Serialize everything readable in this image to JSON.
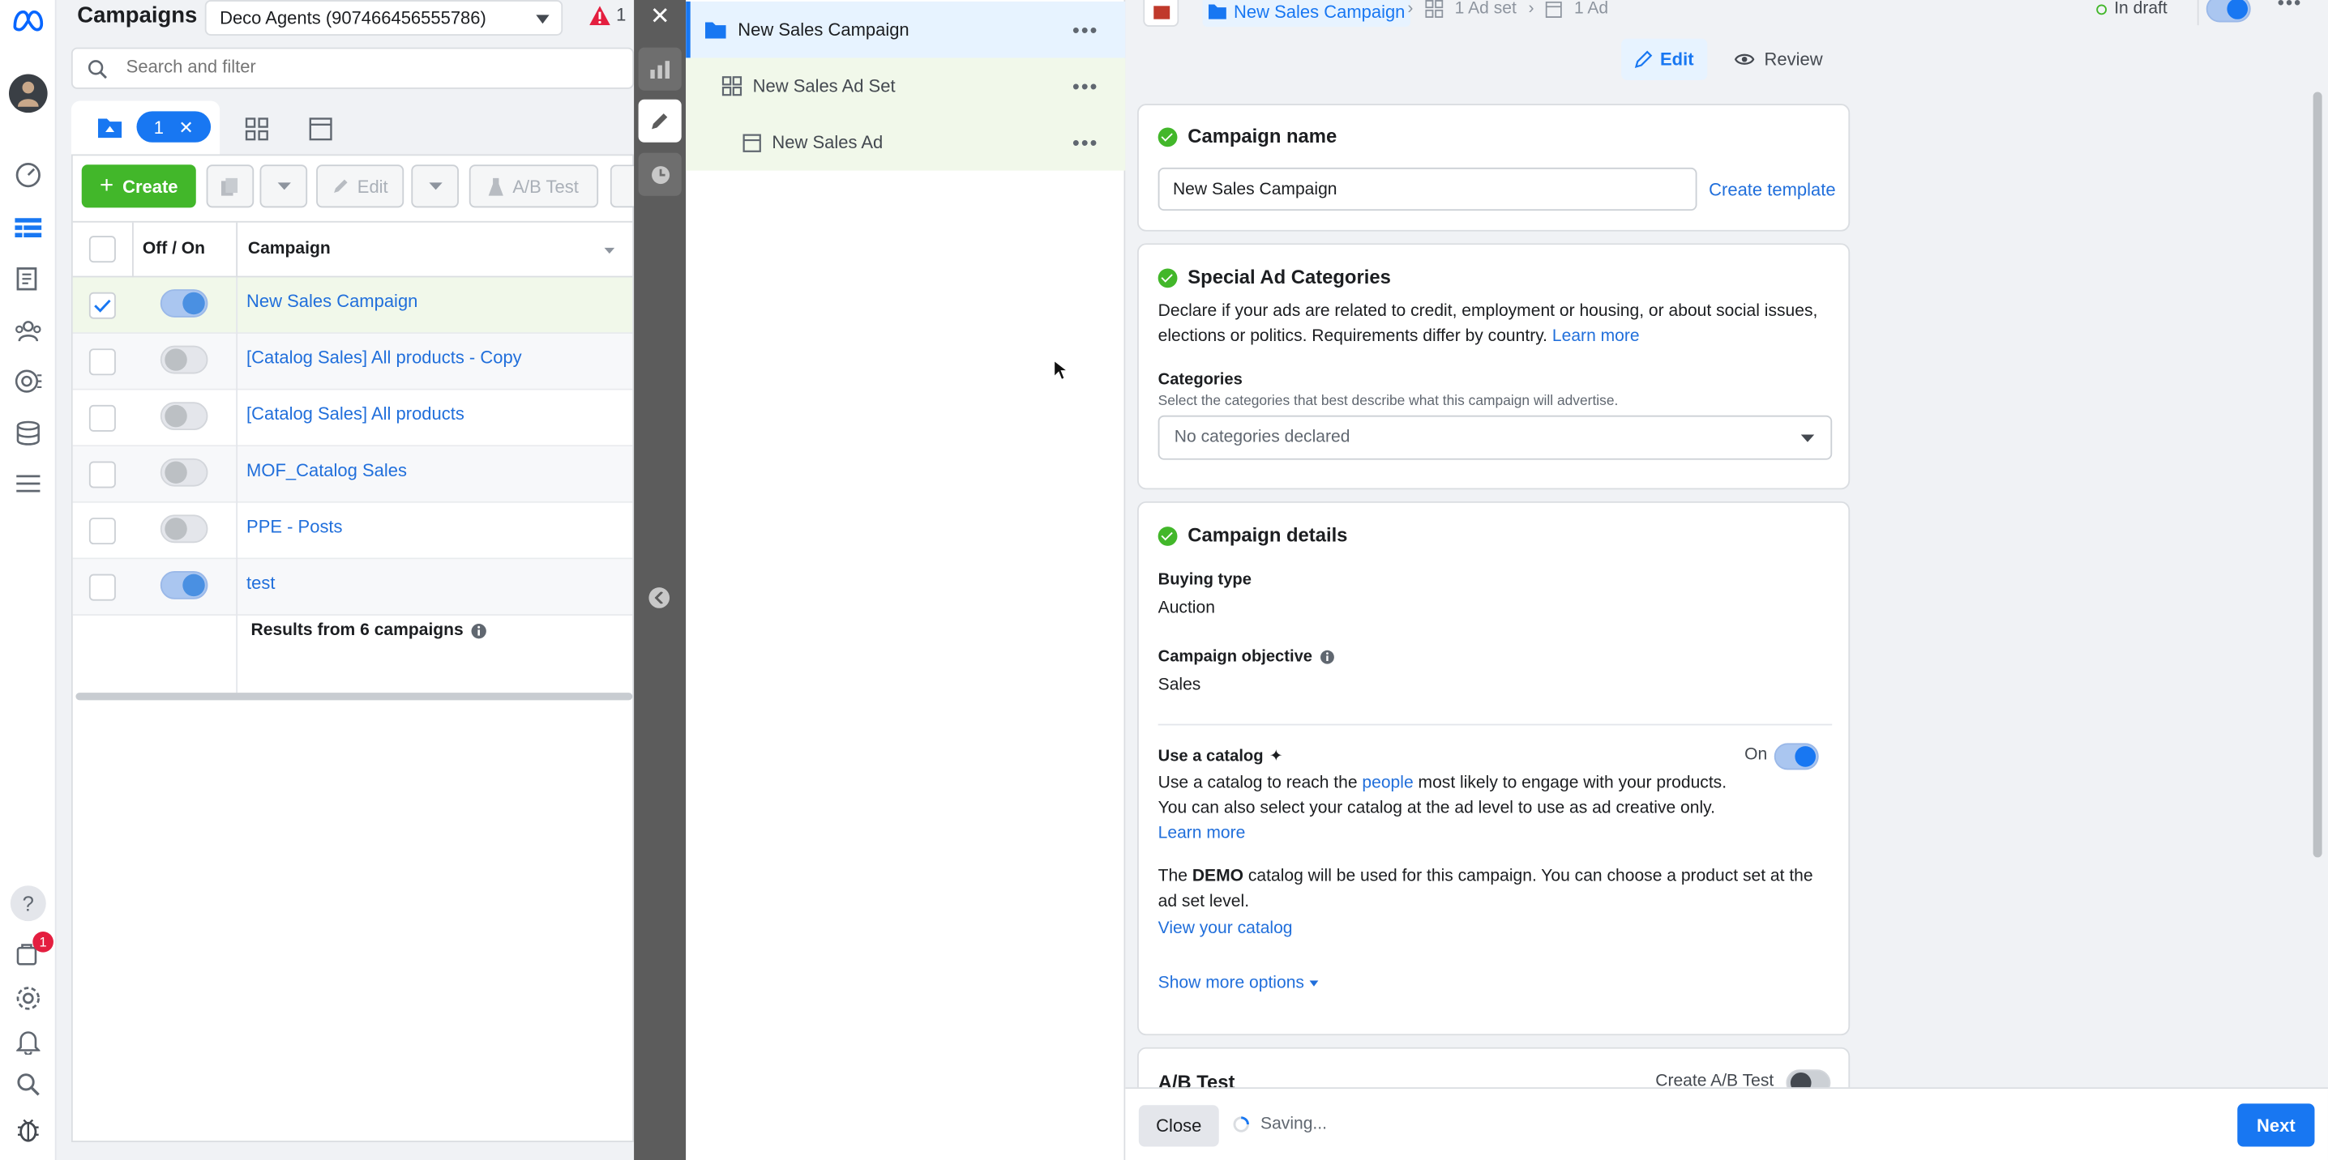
{
  "nav": {
    "help_label": "?",
    "notification_count": "1"
  },
  "campaigns": {
    "title": "Campaigns",
    "account": "Deco Agents (907466456555786)",
    "alert_count": "1",
    "search_placeholder": "Search and filter",
    "filter_count": "1",
    "toolbar": {
      "create": "Create",
      "edit": "Edit",
      "ab_test": "A/B Test"
    },
    "table": {
      "col_toggle": "Off / On",
      "col_campaign": "Campaign",
      "rows": [
        {
          "name": "New Sales Campaign",
          "on": true,
          "selected": true
        },
        {
          "name": "[Catalog Sales] All products - Copy",
          "on": false,
          "selected": false
        },
        {
          "name": "[Catalog Sales] All products",
          "on": false,
          "selected": false
        },
        {
          "name": "MOF_Catalog Sales",
          "on": false,
          "selected": false
        },
        {
          "name": "PPE - Posts",
          "on": false,
          "selected": false
        },
        {
          "name": "test",
          "on": true,
          "selected": false
        }
      ],
      "results": "Results from 6 campaigns"
    }
  },
  "tree": {
    "campaign": "New Sales Campaign",
    "adset": "New Sales Ad Set",
    "ad": "New Sales Ad"
  },
  "editor": {
    "breadcrumb": {
      "campaign": "New Sales Campaign",
      "adset": "1 Ad set",
      "ad": "1 Ad"
    },
    "status": "In draft",
    "tabs": {
      "edit": "Edit",
      "review": "Review"
    },
    "campaign_name": {
      "title": "Campaign name",
      "value": "New Sales Campaign",
      "create_template": "Create template"
    },
    "special": {
      "title": "Special Ad Categories",
      "desc": "Declare if your ads are related to credit, employment or housing, or about social issues, elections or politics. Requirements differ by country.",
      "learn_more": "Learn more",
      "categories_label": "Categories",
      "categories_help": "Select the categories that best describe what this campaign will advertise.",
      "categories_value": "No categories declared"
    },
    "details": {
      "title": "Campaign details",
      "buying_type_label": "Buying type",
      "buying_type": "Auction",
      "objective_label": "Campaign objective",
      "objective": "Sales",
      "catalog_label": "Use a catalog",
      "catalog_toggle": "On",
      "catalog_desc_1": "Use a catalog to reach the",
      "catalog_people": "people",
      "catalog_desc_2": "most likely to engage with your products. You can also select your catalog at the ad level to use as ad creative only.",
      "catalog_learn": "Learn more",
      "demo_pre": "The",
      "demo_name": "DEMO",
      "demo_post": "catalog will be used for this campaign. You can choose a product set at the ad set level.",
      "view_catalog": "View your catalog",
      "show_more": "Show more options"
    },
    "ab_test": {
      "title": "A/B Test",
      "create": "Create A/B Test"
    },
    "footer": {
      "close": "Close",
      "saving": "Saving...",
      "next": "Next"
    }
  },
  "colors": {
    "accent": "#1877f2",
    "green": "#42b72a",
    "link": "#216fdb",
    "strip": "#5c5c5c"
  }
}
